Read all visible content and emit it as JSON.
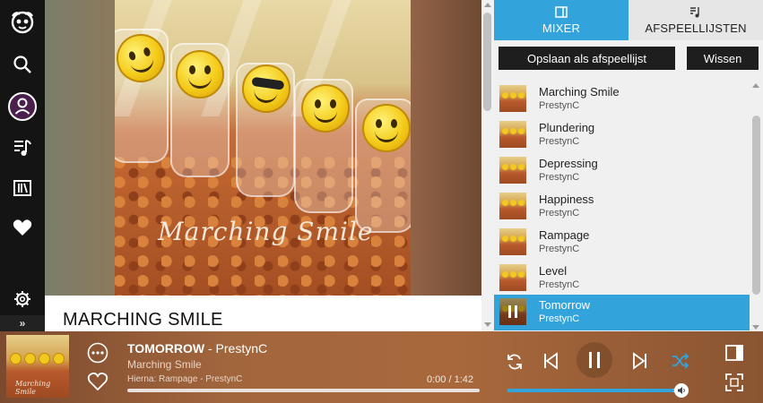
{
  "sidebar": {
    "items": [
      {
        "name": "napster-logo-icon"
      },
      {
        "name": "search-icon"
      },
      {
        "name": "profile-icon"
      },
      {
        "name": "playlist-icon"
      },
      {
        "name": "library-icon"
      },
      {
        "name": "favorites-icon"
      }
    ],
    "settings_icon": "gear-icon",
    "expand_label": "»"
  },
  "main": {
    "cover_text": "Marching Smile",
    "title": "MARCHING SMILE"
  },
  "right_panel": {
    "tabs": [
      {
        "label": "MIXER",
        "icon": "mixer-icon",
        "active": true
      },
      {
        "label": "AFSPEELLIJSTEN",
        "icon": "playlists-icon",
        "active": false
      }
    ],
    "save_button": "Opslaan als afspeellijst",
    "clear_button": "Wissen",
    "queue": [
      {
        "title": "Marching Smile",
        "artist": "PrestynC",
        "current": false
      },
      {
        "title": "Plundering",
        "artist": "PrestynC",
        "current": false
      },
      {
        "title": "Depressing",
        "artist": "PrestynC",
        "current": false
      },
      {
        "title": "Happiness",
        "artist": "PrestynC",
        "current": false
      },
      {
        "title": "Rampage",
        "artist": "PrestynC",
        "current": false
      },
      {
        "title": "Level",
        "artist": "PrestynC",
        "current": false
      },
      {
        "title": "Tomorrow",
        "artist": "PrestynC",
        "current": true
      }
    ]
  },
  "player": {
    "cover_text": "Marching Smile",
    "track_title": "TOMORROW",
    "separator": " - ",
    "artist": "PrestynC",
    "album": "Marching Smile",
    "next_up": "Hierna: Rampage - PrestynC",
    "time": "0:00 / 1:42",
    "progress": 0.0,
    "volume": 0.96,
    "accent_color": "#33a3dc"
  }
}
